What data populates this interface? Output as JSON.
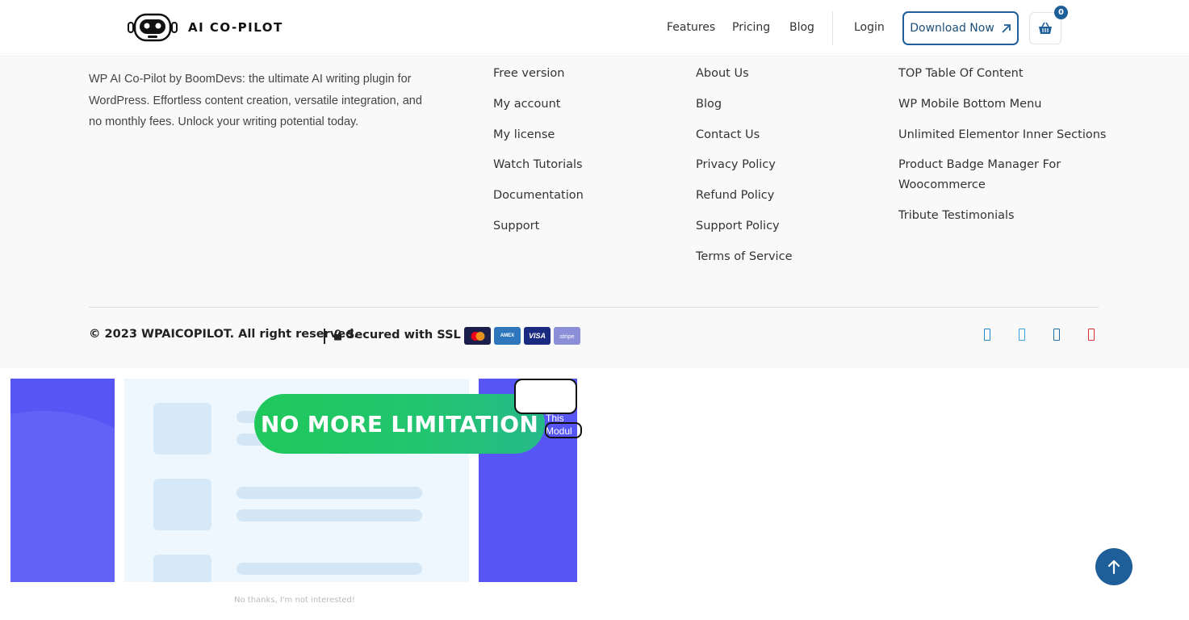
{
  "header": {
    "logo_text": "AI CO-PILOT",
    "nav": {
      "features": "Features",
      "pricing": "Pricing",
      "blog": "Blog",
      "login": "Login"
    },
    "download_label": "Download Now",
    "cart_count": "0"
  },
  "footer": {
    "about": "WP AI Co-Pilot by BoomDevs: the ultimate AI writing plugin for WordPress. Effortless content creation, versatile integration, and no monthly fees. Unlock your writing potential today.",
    "col1": [
      "Free version",
      "My account",
      "My license",
      "Watch Tutorials",
      "Documentation",
      "Support"
    ],
    "col2": [
      "About Us",
      "Blog",
      "Contact Us",
      "Privacy Policy",
      "Refund Policy",
      "Support Policy",
      "Terms of Service"
    ],
    "col3": [
      "TOP Table Of Content",
      "WP Mobile Bottom Menu",
      "Unlimited Elementor Inner Sections",
      "Product Badge Manager For Woocommerce",
      "Tribute Testimonials"
    ],
    "copyright": "© 2023 WPAICOPILOT. All right reserved.",
    "ssl": "Secured with SSL",
    "cards": [
      "mastercard",
      "AMEX",
      "VISA",
      "stripe"
    ],
    "social_colors": [
      "#1e88c8",
      "#3aa0dd",
      "#1e6fa8",
      "#d9302e"
    ]
  },
  "popup": {
    "banner": "NO MORE LIMITATION",
    "bubble_text": "This\nModul",
    "no_thanks": "No thanks, I'm not interested!"
  },
  "colors": {
    "accent": "#1e5f99",
    "popup_bg": "#5756f5",
    "banner_green": "#22c570"
  }
}
